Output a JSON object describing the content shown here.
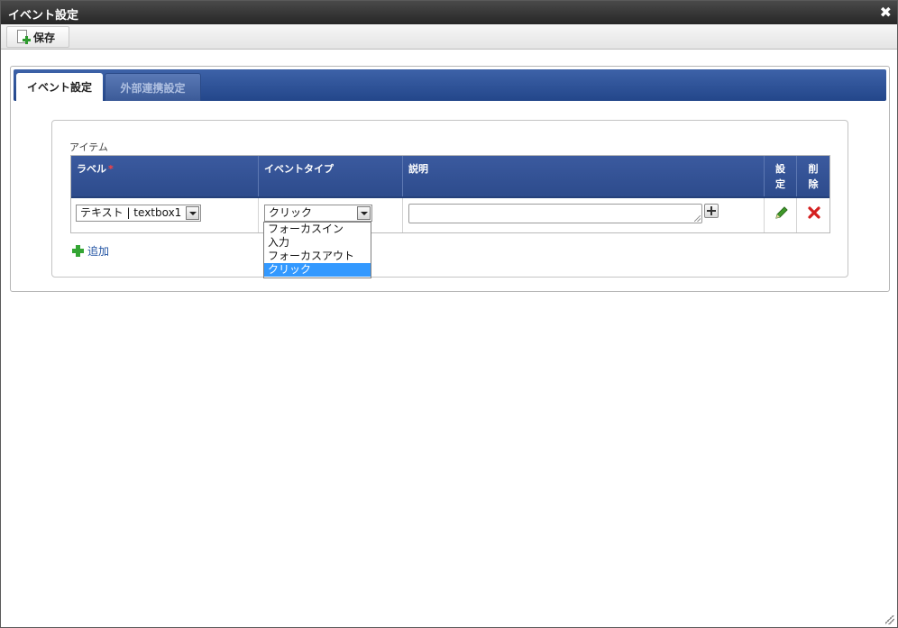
{
  "window": {
    "title": "イベント設定"
  },
  "toolbar": {
    "save_label": "保存"
  },
  "tabs": [
    {
      "label": "イベント設定",
      "active": true
    },
    {
      "label": "外部連携設定",
      "active": false
    }
  ],
  "items_section": {
    "legend": "アイテム",
    "columns": {
      "label": "ラベル",
      "label_required_mark": "*",
      "event_type": "イベントタイプ",
      "description": "説明",
      "settings": "設定",
      "delete": "削除"
    },
    "rows": [
      {
        "label_value": "テキスト | textbox1",
        "event_type_value": "クリック",
        "description_value": ""
      }
    ],
    "add_label": "追加"
  },
  "event_type_options": [
    "フォーカスイン",
    "入力",
    "フォーカスアウト",
    "クリック"
  ],
  "event_type_selected": "クリック",
  "colors": {
    "header_blue": "#2d4b8c",
    "selection_blue": "#3399ff",
    "required_red": "#ff4040",
    "add_green": "#33a533"
  }
}
